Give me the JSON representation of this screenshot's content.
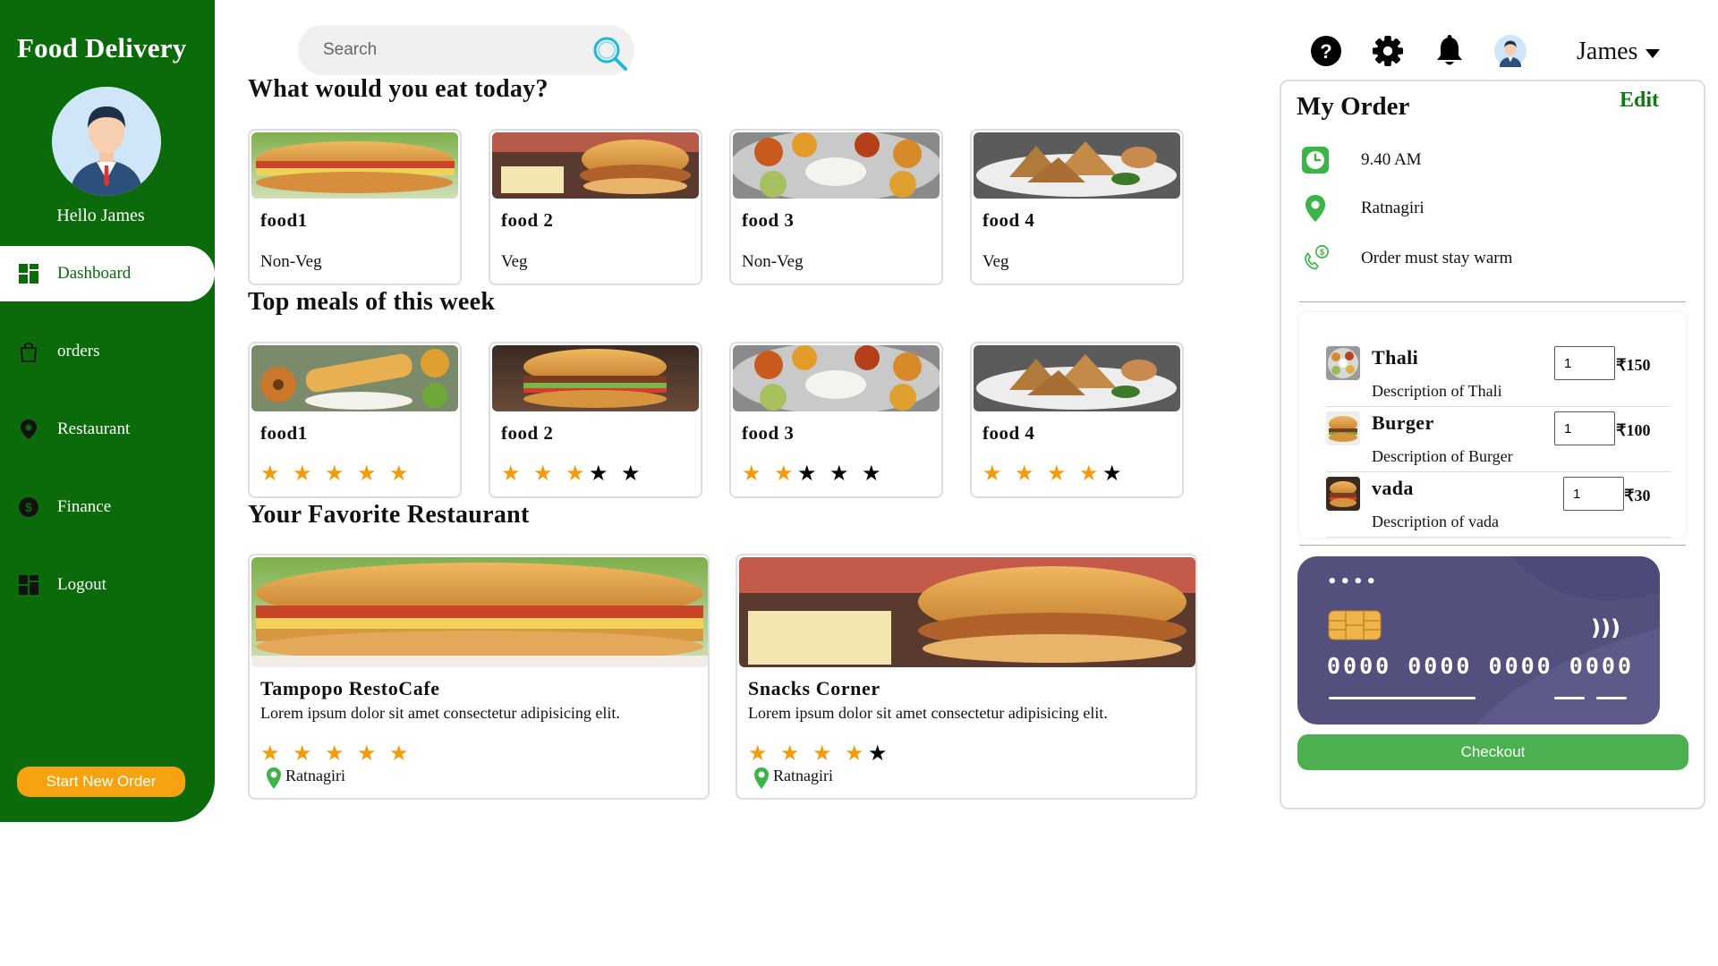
{
  "sidebar": {
    "brand": "Food Delivery",
    "greeting": "Hello James",
    "nav": [
      {
        "label": "Dashboard",
        "icon": "grid-icon"
      },
      {
        "label": "orders",
        "icon": "shopping-bag-icon"
      },
      {
        "label": "Restaurant",
        "icon": "location-pin-icon"
      },
      {
        "label": "Finance",
        "icon": "dollar-coin-icon"
      },
      {
        "label": "Logout",
        "icon": "grid-icon"
      }
    ],
    "start_button": "Start New Order"
  },
  "search": {
    "placeholder": "Search",
    "icon": "search-icon"
  },
  "header": {
    "username": "James",
    "icons": [
      "help-icon",
      "gear-icon",
      "bell-icon",
      "avatar"
    ]
  },
  "sections": {
    "today": "What would you eat today?",
    "top": "Top meals of this week",
    "fav": "Your Favorite Restaurant"
  },
  "today_foods": [
    {
      "name": "food1",
      "type": "Non-Veg"
    },
    {
      "name": "food 2",
      "type": "Veg"
    },
    {
      "name": "food 3",
      "type": "Non-Veg"
    },
    {
      "name": "food 4",
      "type": "Veg"
    }
  ],
  "top_meals": [
    {
      "name": "food1",
      "rating": 5
    },
    {
      "name": "food 2",
      "rating": 3
    },
    {
      "name": "food 3",
      "rating": 2
    },
    {
      "name": "food 4",
      "rating": 4
    }
  ],
  "restaurants": [
    {
      "name": "Tampopo RestoCafe",
      "desc": "Lorem ipsum dolor sit amet consectetur adipisicing elit.",
      "rating": 5,
      "location": "Ratnagiri"
    },
    {
      "name": "Snacks Corner",
      "desc": "Lorem ipsum dolor sit amet consectetur adipisicing elit.",
      "rating": 4,
      "location": "Ratnagiri"
    }
  ],
  "order": {
    "title": "My Order",
    "edit": "Edit",
    "time": "9.40 AM",
    "location": "Ratnagiri",
    "note": "Order must stay warm",
    "items": [
      {
        "name": "Thali",
        "desc": "Description of Thali",
        "qty": "1",
        "price": "₹150"
      },
      {
        "name": "Burger",
        "desc": "Description of Burger",
        "qty": "1",
        "price": "₹100"
      },
      {
        "name": "vada",
        "desc": "Description of vada",
        "qty": "1",
        "price": "₹30"
      }
    ],
    "card": {
      "number": "0000 0000 0000 0000",
      "dots": "••••"
    },
    "checkout": "Checkout"
  },
  "colors": {
    "sidebar": "#0b6b0b",
    "accent_orange": "#f6a211",
    "star": "#f59b0b",
    "checkout": "#4caf50",
    "card": "#54507e"
  }
}
